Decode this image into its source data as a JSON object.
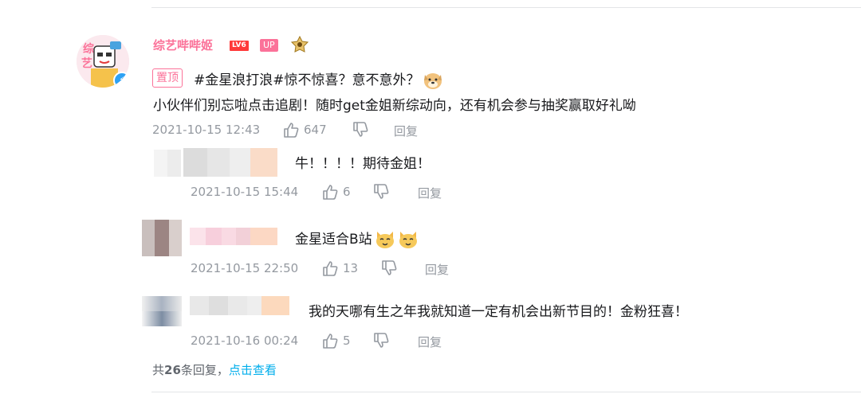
{
  "main_comment": {
    "username": "综艺哔哔姬",
    "level_badge": "LV6",
    "up_badge": "UP",
    "pinned_label": "置顶",
    "line1": "#金星浪打浪#惊不惊喜？意不意外？",
    "line2": "小伙伴们别忘啦点击追剧！随时get金姐新综动向，还有机会参与抽奖赢取好礼呦",
    "time": "2021-10-15 12:43",
    "likes": "647",
    "reply_label": "回复"
  },
  "replies": [
    {
      "text": "牛！！！！期待金姐！",
      "time": "2021-10-15 15:44",
      "likes": "6",
      "reply_label": "回复"
    },
    {
      "text": "金星适合B站",
      "time": "2021-10-15 22:50",
      "likes": "13",
      "reply_label": "回复"
    },
    {
      "text": "我的天哪有生之年我就知道一定有机会出新节目的！金粉狂喜！",
      "time": "2021-10-16 00:24",
      "likes": "5",
      "reply_label": "回复"
    }
  ],
  "more_replies": {
    "prefix": "共",
    "count": "26",
    "suffix": "条回复，",
    "link": "点击查看"
  },
  "icons": [
    "thumbs-up-icon",
    "thumbs-down-icon",
    "doge-emoji-icon",
    "cat-emoji-icon",
    "verified-icon",
    "medal-icon"
  ],
  "colors": {
    "accent_pink": "#fb7299",
    "meta_gray": "#9499a0",
    "link_blue": "#00aeec",
    "text": "#18191c"
  }
}
